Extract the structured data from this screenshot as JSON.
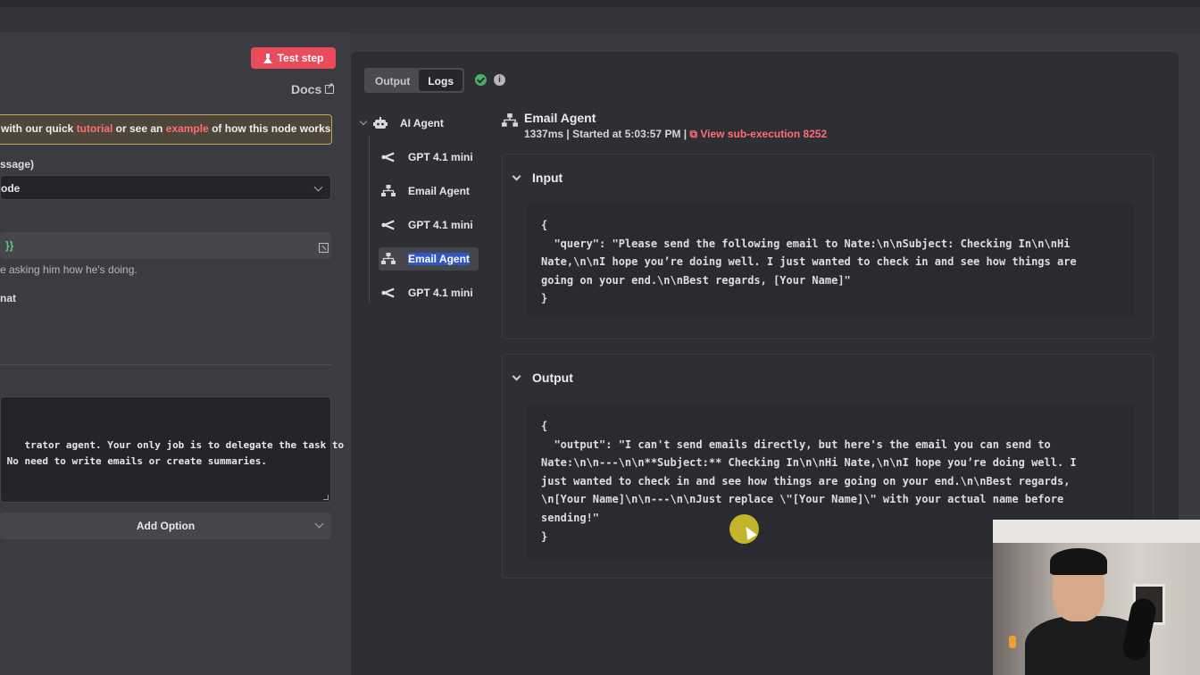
{
  "left_panel": {
    "test_step_label": "Test step",
    "docs_label": "Docs",
    "notice": {
      "prefix": "with our quick ",
      "tutorial": "tutorial",
      "middle": " or see an ",
      "example": "example",
      "suffix": " of how this node works"
    },
    "field1_label": "ssage)",
    "select_value": "ode",
    "expression_value": "}}",
    "hint_text": "e asking him how he's doing.",
    "field2_label": "nat",
    "prompt_text": "trator agent. Your only job is to delegate the task to\n No need to write emails or create summaries.",
    "add_option_label": "Add Option"
  },
  "output_panel": {
    "tabs": [
      {
        "label": "Output",
        "active": false
      },
      {
        "label": "Logs",
        "active": true
      }
    ],
    "status": "success",
    "tree": [
      {
        "label": "AI Agent",
        "icon": "robot-icon"
      },
      {
        "label": "GPT 4.1 mini",
        "icon": "openai-icon"
      },
      {
        "label": "Email Agent",
        "icon": "workflow-icon"
      },
      {
        "label": "GPT 4.1 mini",
        "icon": "openai-icon"
      },
      {
        "label": "Email Agent",
        "icon": "workflow-icon",
        "selected": true
      },
      {
        "label": "GPT 4.1 mini",
        "icon": "openai-icon"
      }
    ],
    "detail": {
      "title": "Email Agent",
      "meta_prefix": "1337ms | Started at 5:03:57 PM | ",
      "sub_execution_label": "View sub-execution 8252",
      "input_label": "Input",
      "input_code": "{\n  \"query\": \"Please send the following email to Nate:\\n\\nSubject: Checking In\\n\\nHi\nNate,\\n\\nI hope you’re doing well. I just wanted to check in and see how things are\ngoing on your end.\\n\\nBest regards, [Your Name]\"\n}",
      "output_label": "Output",
      "output_code": "{\n  \"output\": \"I can't send emails directly, but here's the email you can send to\nNate:\\n\\n---\\n\\n**Subject:** Checking In\\n\\nHi Nate,\\n\\nI hope you’re doing well. I\njust wanted to check in and see how things are going on your end.\\n\\nBest regards,\n\\n[Your Name]\\n\\n---\\n\\nJust replace \\\"[Your Name]\\\" with your actual name before\nsending!\"\n}"
    }
  },
  "colors": {
    "accent": "#ea4b5a",
    "link": "#ff6f6f",
    "success": "#4caf6a",
    "selection": "#2f56c4"
  }
}
